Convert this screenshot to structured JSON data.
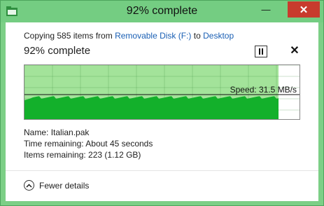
{
  "window": {
    "title": "92% complete",
    "controls": {
      "minimize": "—",
      "maximize": "□",
      "close": "✕"
    }
  },
  "copy": {
    "prefix": "Copying 585 items from ",
    "source": "Removable Disk (F:)",
    "middle": " to ",
    "destination": "Desktop"
  },
  "progress": {
    "heading": "92% complete",
    "fraction": 0.92,
    "speed_label": "Speed: 31.5 MB/s"
  },
  "details": {
    "name_label": "Name:",
    "name_value": "Italian.pak",
    "time_label": "Time remaining:",
    "time_value": "About 45 seconds",
    "items_label": "Items remaining:",
    "items_value": "223 (1.12 GB)"
  },
  "footer": {
    "fewer_details": "Fewer details"
  },
  "colors": {
    "accent_green": "#6cca7a",
    "graph_fill": "#13b02b",
    "graph_background": "#a3e39a",
    "close_red": "#c83b2d",
    "link_blue": "#1a5fb4"
  },
  "icons": {
    "app": "folder-copy-icon",
    "pause": "pause-icon",
    "cancel": "close-icon",
    "chevron": "chevron-up-circle-icon"
  }
}
